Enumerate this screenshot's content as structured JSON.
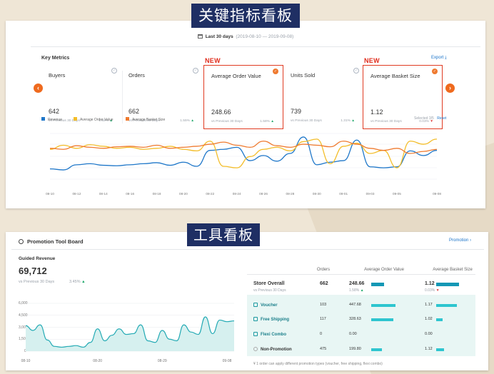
{
  "header_top": {
    "title": "关键指标看板"
  },
  "header_bottom": {
    "title": "工具看板"
  },
  "key_metrics": {
    "date_range_label": "Last 30 days",
    "date_range": "(2019-08-10 — 2019-09-08)",
    "title": "Key Metrics",
    "export_label": "Export",
    "new_badge": "NEW",
    "cards": [
      {
        "name": "Buyers",
        "value": "642",
        "vs": "vs Previous 30 Days",
        "change": "1.58%",
        "dir": "up",
        "selected": false
      },
      {
        "name": "Orders",
        "value": "662",
        "vs": "vs Previous 30 Days",
        "change": "1.55%",
        "dir": "up",
        "selected": false
      },
      {
        "name": "Average Order Value",
        "value": "248.66",
        "vs": "vs Previous 30 Days",
        "change": "1.58%",
        "dir": "up",
        "selected": true
      },
      {
        "name": "Units Sold",
        "value": "739",
        "vs": "vs Previous 30 Days",
        "change": "1.31%",
        "dir": "up",
        "selected": false
      },
      {
        "name": "Average Basket Size",
        "value": "1.12",
        "vs": "vs Previous 30 Days",
        "change": "0.03%",
        "dir": "down",
        "selected": true
      }
    ],
    "legend": [
      {
        "name": "Revenue",
        "color": "#1f77c9"
      },
      {
        "name": "Average Order Value",
        "color": "#f3bd2a"
      },
      {
        "name": "Average Basket Size",
        "color": "#ef7a2f"
      }
    ],
    "selected_label": "Selected",
    "selected_count": "3/5",
    "reset_label": "Reset",
    "x_ticks": [
      "08-10",
      "08-12",
      "08-14",
      "08-16",
      "08-18",
      "08-20",
      "08-22",
      "08-24",
      "08-26",
      "08-28",
      "08-30",
      "09-01",
      "09-03",
      "09-05",
      "09-08"
    ]
  },
  "promotion_board": {
    "title": "Promotion Tool Board",
    "link_label": "Promotion",
    "guided_revenue_title": "Guided Revenue",
    "guided_revenue_value": "69,712",
    "vs": "vs Previous 30 Days",
    "change": "3.45%",
    "change_dir": "up",
    "y_ticks": [
      "6,000",
      "4,500",
      "3,000",
      "1,500",
      "0"
    ],
    "x_ticks": [
      "08-10",
      "08-20",
      "08-29",
      "09-08"
    ],
    "columns": [
      "Orders",
      "Average Order Value",
      "Average Basket Size"
    ],
    "overall": {
      "label": "Store Overall",
      "vs": "vs Previous 30 Days",
      "orders": "662",
      "aov": "248.66",
      "aov_change": "1.58%",
      "aov_dir": "up",
      "abs": "1.12",
      "abs_change": "0.03%",
      "abs_dir": "down"
    },
    "rows": [
      {
        "label": "Voucher",
        "orders": "103",
        "aov": "447.68",
        "abs": "1.17",
        "aov_frac": 0.65,
        "abs_frac": 0.9
      },
      {
        "label": "Free Shipping",
        "orders": "117",
        "aov": "328.63",
        "abs": "1.02",
        "aov_frac": 0.6,
        "abs_frac": 0.28
      },
      {
        "label": "Flexi Combo",
        "orders": "0",
        "aov": "0.00",
        "abs": "0.00",
        "aov_frac": 0,
        "abs_frac": 0
      },
      {
        "label": "Non-Promotion",
        "orders": "475",
        "aov": "199.80",
        "abs": "1.12",
        "aov_frac": 0.28,
        "abs_frac": 0.33
      }
    ],
    "footnote": "¥ 1 order can apply different promotion types (voucher, free shipping, flexi combo)"
  },
  "chart_data": [
    {
      "type": "line",
      "x": [
        "08-10",
        "08-11",
        "08-12",
        "08-13",
        "08-14",
        "08-15",
        "08-16",
        "08-17",
        "08-18",
        "08-19",
        "08-20",
        "08-21",
        "08-22",
        "08-23",
        "08-24",
        "08-25",
        "08-26",
        "08-27",
        "08-28",
        "08-29",
        "08-30",
        "08-31",
        "09-01",
        "09-02",
        "09-03",
        "09-04",
        "09-05",
        "09-06",
        "09-07",
        "09-08"
      ],
      "series": [
        {
          "name": "Revenue",
          "color": "#1f77c9",
          "values": [
            20,
            18,
            28,
            30,
            27,
            26,
            28,
            30,
            32,
            27,
            33,
            25,
            56,
            58,
            62,
            36,
            46,
            35,
            50,
            82,
            28,
            33,
            36,
            76,
            24,
            22,
            24,
            55,
            46,
            56
          ]
        },
        {
          "name": "Average Order Value",
          "color": "#f3bd2a",
          "values": [
            58,
            66,
            60,
            67,
            64,
            60,
            62,
            58,
            60,
            64,
            58,
            55,
            74,
            25,
            22,
            44,
            58,
            62,
            55,
            73,
            78,
            30,
            64,
            70,
            50,
            56,
            22,
            74,
            68,
            78
          ]
        },
        {
          "name": "Average Basket Size",
          "color": "#ef7a2f",
          "values": [
            60,
            58,
            65,
            62,
            60,
            63,
            64,
            62,
            66,
            60,
            62,
            64,
            68,
            72,
            66,
            62,
            74,
            65,
            62,
            68,
            66,
            63,
            74,
            68,
            60,
            56,
            60,
            50,
            54,
            58
          ]
        }
      ],
      "grid": true,
      "legend": "top-left"
    },
    {
      "type": "area",
      "x": [
        "08-10",
        "08-11",
        "08-12",
        "08-13",
        "08-14",
        "08-15",
        "08-16",
        "08-17",
        "08-18",
        "08-19",
        "08-20",
        "08-21",
        "08-22",
        "08-23",
        "08-24",
        "08-25",
        "08-26",
        "08-27",
        "08-28",
        "08-29",
        "08-30",
        "08-31",
        "09-01",
        "09-02",
        "09-03",
        "09-04",
        "09-05",
        "09-06",
        "09-07",
        "09-08"
      ],
      "series": [
        {
          "values": [
            3200,
            2600,
            3300,
            1400,
            600,
            500,
            600,
            700,
            500,
            1100,
            2800,
            1300,
            2000,
            2800,
            2100,
            2200,
            3300,
            1300,
            1100,
            2600,
            1500,
            1300,
            3300,
            2400,
            2100,
            4300,
            2200,
            3900,
            3700,
            3800
          ]
        }
      ],
      "ylim": [
        0,
        6000
      ],
      "y_ticks": [
        0,
        1500,
        3000,
        4500,
        6000
      ],
      "grid": true
    }
  ]
}
